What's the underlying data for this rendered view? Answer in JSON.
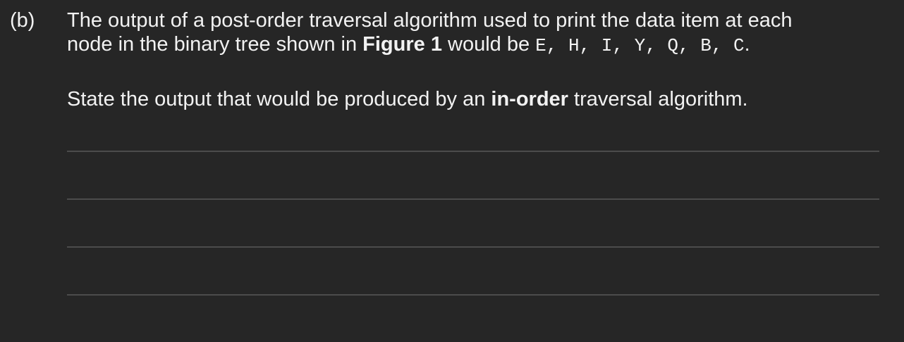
{
  "question": {
    "part_label": "(b)",
    "line1": "The output of a post-order traversal algorithm used to print the data item at each",
    "line2_start": "node in the binary tree shown in ",
    "figure_ref": "Figure 1",
    "line2_mid": " would be ",
    "sequence": "E, H, I, Y, Q, B, C",
    "line2_end": ".",
    "instruction_start": "State the output that would be produced by an ",
    "instruction_bold": "in-order",
    "instruction_end": " traversal algorithm."
  },
  "answer_area": {
    "line_count": 4
  }
}
